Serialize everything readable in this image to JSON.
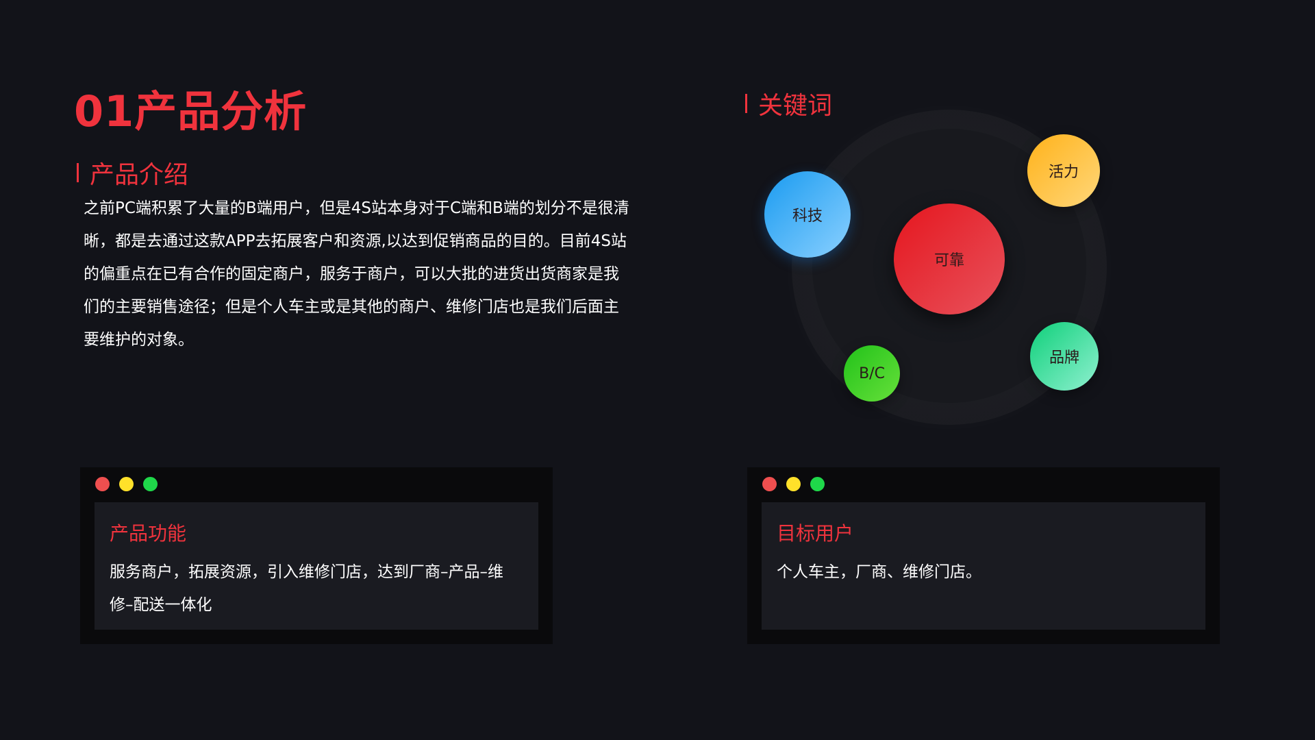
{
  "page": {
    "title": "01产品分析"
  },
  "intro": {
    "heading": "产品介绍",
    "paragraph": "之前PC端积累了大量的B端用户，但是4S站本身对于C端和B端的划分不是很清晰，都是去通过这款APP去拓展客户和资源,以达到促销商品的目的。目前4S站的偏重点在已有合作的固定商户，服务于商户，可以大批的进货出货商家是我们的主要销售途径；但是个人车主或是其他的商户、维修门店也是我们后面主要维护的对象。"
  },
  "keywords": {
    "heading": "关键词",
    "items": {
      "tech": "科技",
      "reliable": "可靠",
      "vital": "活力",
      "brand": "品牌",
      "bc": "B/C"
    },
    "colors": {
      "tech": "#1a9bf0",
      "reliable": "#e5161e",
      "vital": "#ffb21a",
      "brand": "#0fd07a",
      "bc": "#22c21a"
    }
  },
  "cards": {
    "features": {
      "title": "产品功能",
      "text": "服务商户，拓展资源，引入维修门店，达到厂商–产品–维修–配送一体化"
    },
    "target_users": {
      "title": "目标用户",
      "text": "个人车主，厂商、维修门店。"
    }
  },
  "colors": {
    "accent": "#f0333d",
    "background": "#121319"
  }
}
